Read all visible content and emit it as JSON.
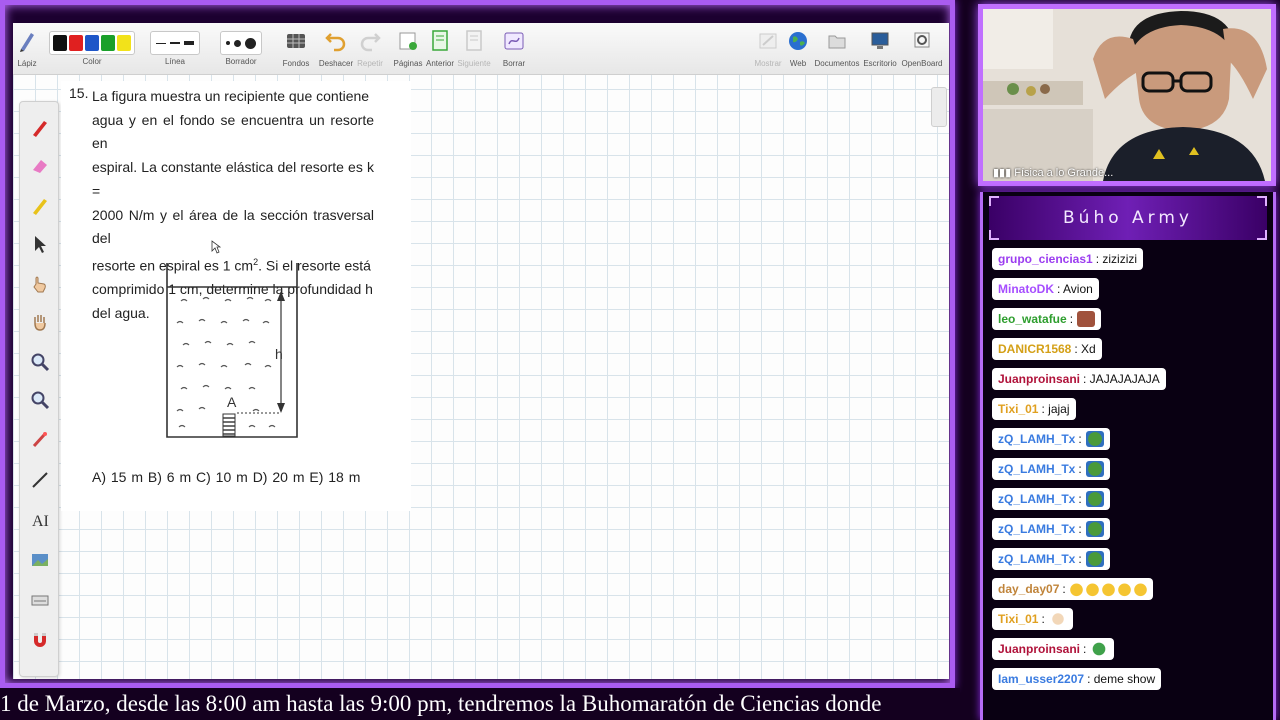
{
  "toolbar": {
    "pencil_label": "Lápiz",
    "color_label": "Color",
    "line_label": "Línea",
    "eraser_label": "Borrador",
    "backgrounds_label": "Fondos",
    "undo_label": "Deshacer",
    "redo_label": "Repetir",
    "pages_label": "Páginas",
    "previous_label": "Anterior",
    "next_label": "Siguiente",
    "erase_label": "Borrar",
    "show_label": "Mostrar",
    "web_label": "Web",
    "documents_label": "Documentos",
    "desktop_label": "Escritorio",
    "openboard_label": "OpenBoard",
    "colors": [
      "#111111",
      "#e02020",
      "#1e56c8",
      "#1aa02a",
      "#f2e21a"
    ]
  },
  "question": {
    "number": "15.",
    "line1": "La figura muestra un recipiente que contiene",
    "line2": "agua y en el fondo se encuentra un resorte en",
    "line3": "espiral. La constante elástica del resorte es k =",
    "line4": "2000 N/m y el área de la sección trasversal del",
    "line5a": "resorte en espiral es 1 cm",
    "line5sup": "2",
    "line5b": ". Si el resorte está",
    "line6": "comprimido 1 cm, determine la profundidad h",
    "line7": "del agua.",
    "figure_h": "h",
    "figure_a": "A",
    "answers": "A) 15 m   B) 6 m   C) 10 m   D) 20 m   E) 18 m"
  },
  "webcam": {
    "label": "Física a lo Grande..."
  },
  "chat": {
    "title": "Búho Army",
    "messages": [
      {
        "user": "grupo_ciencias1",
        "text": ": zizizizi",
        "color": "#9b3cf0"
      },
      {
        "user": "MinatoDK",
        "text": ": Avion",
        "color": "#a64dff"
      },
      {
        "user": "leo_watafue",
        "text": ":",
        "color": "#2e9e2e",
        "emoji": "pixel-face-emote"
      },
      {
        "user": "DANICR1568",
        "text": ": Xd",
        "color": "#d4a017"
      },
      {
        "user": "Juanproinsani",
        "text": ": JAJAJAJAJA",
        "color": "#b0123a"
      },
      {
        "user": "Tixi_01",
        "text": ": jajaj",
        "color": "#e0a020"
      },
      {
        "user": "zQ_LAMH_Tx",
        "text": ":",
        "color": "#3a7be0",
        "emoji": "pepe-emote"
      },
      {
        "user": "zQ_LAMH_Tx",
        "text": ":",
        "color": "#3a7be0",
        "emoji": "pepe-emote"
      },
      {
        "user": "zQ_LAMH_Tx",
        "text": ":",
        "color": "#3a7be0",
        "emoji": "pepe-emote"
      },
      {
        "user": "zQ_LAMH_Tx",
        "text": ":",
        "color": "#3a7be0",
        "emoji": "pepe-emote"
      },
      {
        "user": "zQ_LAMH_Tx",
        "text": ":",
        "color": "#3a7be0",
        "emoji": "pepe-emote"
      },
      {
        "user": "day_day07",
        "text": ":",
        "color": "#c0843a",
        "emoji": "clap-emojis"
      },
      {
        "user": "Tixi_01",
        "text": ":",
        "color": "#e0a020",
        "emoji": "hand-emoji"
      },
      {
        "user": "Juanproinsani",
        "text": ":",
        "color": "#b0123a",
        "emoji": "sick-face-emoji"
      },
      {
        "user": "Iam_usser2207",
        "text": ": deme show",
        "color": "#3a7be0"
      }
    ]
  },
  "ticker": {
    "text": "1 de Marzo, desde las 8:00 am hasta las 9:00 pm, tendremos la Buhomaratón de Ciencias donde"
  }
}
